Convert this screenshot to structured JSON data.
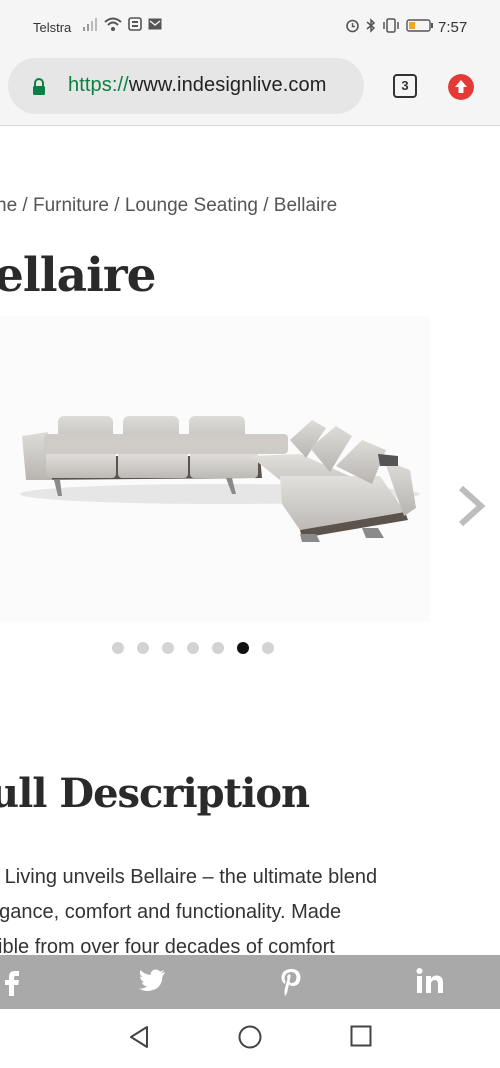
{
  "status_bar": {
    "carrier": "Telstra",
    "time": "7:57",
    "icons": [
      "signal-icon",
      "wifi-icon",
      "news-icon",
      "mail-icon",
      "alarm-icon",
      "bluetooth-icon",
      "vibrate-icon",
      "battery-icon"
    ],
    "battery_color": "#f5a623"
  },
  "browser": {
    "url_scheme": "https://",
    "url_host": "www.indesignlive.com",
    "tab_count": "3",
    "accent_secure": "#0b8043",
    "upload_color": "#e53935"
  },
  "page": {
    "breadcrumb": "ne / Furniture / Lounge Seating / Bellaire",
    "title": "ellaire",
    "gallery": {
      "image_alt": "Bellaire modular corner sofa",
      "dot_count": 7,
      "active_dot": 6
    },
    "section_title": "ull Description",
    "description_lines": [
      "n Living unveils Bellaire – the ultimate blend",
      "egance, comfort and functionality. Made",
      "sible from over four decades of comfort"
    ]
  },
  "share_bar": {
    "icons": [
      "facebook-icon",
      "twitter-icon",
      "pinterest-icon",
      "linkedin-icon"
    ],
    "background": "#a9a9a9"
  },
  "nav_bar": {
    "icons": [
      "back-icon",
      "home-icon",
      "recents-icon"
    ]
  }
}
